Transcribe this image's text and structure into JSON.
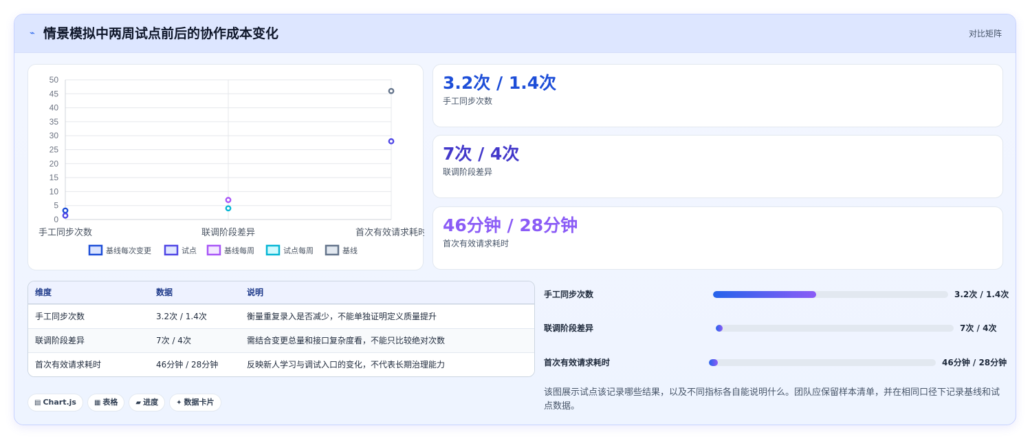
{
  "header": {
    "icon": "sparkline-icon",
    "title": "情景模拟中两周试点前后的协作成本变化",
    "badge": "对比矩阵"
  },
  "chart_data": {
    "type": "scatter",
    "categories": [
      "手工同步次数",
      "联调阶段差异",
      "首次有效请求耗时"
    ],
    "ylim": [
      0,
      50
    ],
    "yticks": [
      0,
      5,
      10,
      15,
      20,
      25,
      30,
      35,
      40,
      45,
      50
    ],
    "legend_position": "bottom",
    "grid": true,
    "series": [
      {
        "name": "基线每次变更",
        "color": "#1d4ed8",
        "category": 0,
        "value": 3.2
      },
      {
        "name": "试点",
        "color": "#4f46e5",
        "category": 0,
        "value": 1.4
      },
      {
        "name": "基线每周",
        "color": "#a855f7",
        "category": 1,
        "value": 7
      },
      {
        "name": "试点每周",
        "color": "#06b6d4",
        "category": 1,
        "value": 4
      },
      {
        "name": "基线",
        "color": "#64748b",
        "category": 2,
        "value": 46
      },
      {
        "name": "试点",
        "color": "#4f46e5",
        "category": 2,
        "value": 28
      }
    ],
    "legend": [
      {
        "name": "基线每次变更",
        "color": "#1d4ed8",
        "fill": "#dbe4ff"
      },
      {
        "name": "试点",
        "color": "#4f46e5",
        "fill": "#e0e7ff"
      },
      {
        "name": "基线每周",
        "color": "#a855f7",
        "fill": "#f3e8ff"
      },
      {
        "name": "试点每周",
        "color": "#06b6d4",
        "fill": "#cffafe"
      },
      {
        "name": "基线",
        "color": "#64748b",
        "fill": "#e2e8f0"
      }
    ]
  },
  "stats": [
    {
      "value": "3.2次 / 1.4次",
      "label": "手工同步次数",
      "color": "#1d4ed8"
    },
    {
      "value": "7次 / 4次",
      "label": "联调阶段差异",
      "color": "#4338ca"
    },
    {
      "value": "46分钟 / 28分钟",
      "label": "首次有效请求耗时",
      "color": "#8b5cf6"
    }
  ],
  "table": {
    "headers": [
      "维度",
      "数据",
      "说明"
    ],
    "rows": [
      [
        "手工同步次数",
        "3.2次 / 1.4次",
        "衡量重复录入是否减少，不能单独证明定义质量提升"
      ],
      [
        "联调阶段差异",
        "7次 / 4次",
        "需结合变更总量和接口复杂度看，不能只比较绝对次数"
      ],
      [
        "首次有效请求耗时",
        "46分钟 / 28分钟",
        "反映新人学习与调试入口的变化，不代表长期治理能力"
      ]
    ]
  },
  "progress": [
    {
      "label": "手工同步次数",
      "value": "3.2次 / 1.4次",
      "fraction": 0.44
    },
    {
      "label": "联调阶段差异",
      "value": "7次 / 4次",
      "fraction": 0.03
    },
    {
      "label": "首次有效请求耗时",
      "value": "46分钟 / 28分钟",
      "fraction": 0.04
    }
  ],
  "tags": [
    {
      "icon": "chart-icon",
      "glyph": "▤",
      "label": "Chart.js"
    },
    {
      "icon": "table-icon",
      "glyph": "▦",
      "label": "表格"
    },
    {
      "icon": "progress-icon",
      "glyph": "▰",
      "label": "进度"
    },
    {
      "icon": "sparkle-icon",
      "glyph": "✦",
      "label": "数据卡片"
    }
  ],
  "note": "该图展示试点该记录哪些结果，以及不同指标各自能说明什么。团队应保留样本清单，并在相同口径下记录基线和试点数据。"
}
